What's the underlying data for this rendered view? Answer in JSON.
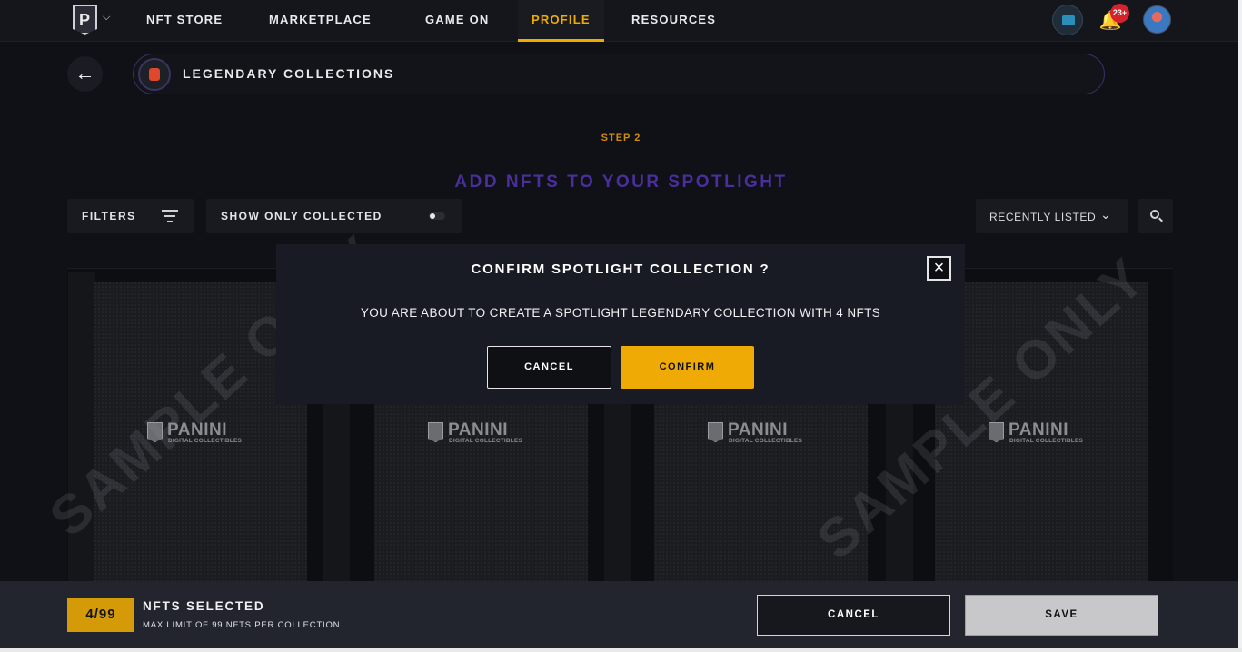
{
  "nav": {
    "items": [
      {
        "label": "NFT STORE"
      },
      {
        "label": "MARKETPLACE"
      },
      {
        "label": "GAME ON"
      },
      {
        "label": "PROFILE",
        "active": true
      },
      {
        "label": "RESOURCES"
      }
    ],
    "notification_count": "23+",
    "icons": [
      "panini-logo-icon",
      "chevron-down-icon",
      "wallet-icon",
      "bell-icon",
      "avatar"
    ]
  },
  "header": {
    "back_icon": "arrow-left-icon",
    "collection_title": "LEGENDARY COLLECTIONS"
  },
  "step": "STEP 2",
  "heading": "ADD NFTS TO YOUR SPOTLIGHT",
  "controls": {
    "filters_label": "FILTERS",
    "show_collected_label": "SHOW ONLY COLLECTED",
    "show_collected_on": false,
    "sort_label": "RECENTLY LISTED",
    "search_icon": "search-icon"
  },
  "cards": [
    {
      "brand": "PANINI",
      "brand_sub": "DIGITAL COLLECTIBLES"
    },
    {
      "brand": "PANINI",
      "brand_sub": "DIGITAL COLLECTIBLES"
    },
    {
      "brand": "PANINI",
      "brand_sub": "DIGITAL COLLECTIBLES"
    },
    {
      "brand": "PANINI",
      "brand_sub": "DIGITAL COLLECTIBLES"
    }
  ],
  "watermark": "SAMPLE ONLY",
  "modal": {
    "title": "CONFIRM SPOTLIGHT COLLECTION ?",
    "message": "YOU ARE ABOUT TO CREATE A SPOTLIGHT LEGENDARY COLLECTION WITH 4 NFTS",
    "cancel_label": "CANCEL",
    "confirm_label": "CONFIRM",
    "close_icon": "close-icon"
  },
  "footer": {
    "count": "4/99",
    "title": "NFTS SELECTED",
    "subtitle": "MAX LIMIT OF 99 NFTS PER COLLECTION",
    "cancel_label": "CANCEL",
    "save_label": "SAVE"
  },
  "colors": {
    "accent": "#f0ab00",
    "heading": "#4a2f9c",
    "background": "#0f1116"
  }
}
